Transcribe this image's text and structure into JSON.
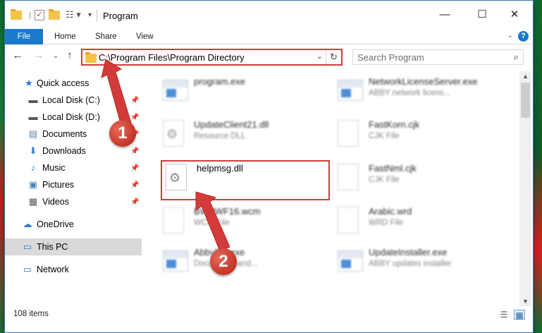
{
  "window": {
    "title": "Program",
    "controls": {
      "minimize": "—",
      "maximize": "☐",
      "close": "✕"
    }
  },
  "ribbon": {
    "tabs": [
      "File",
      "Home",
      "Share",
      "View"
    ],
    "help": "?"
  },
  "nav": {
    "back": "←",
    "forward": "→",
    "recent": "⌄",
    "up": "↑",
    "address": "C:\\Program Files\\Program Directory",
    "search_placeholder": "Search Program"
  },
  "sidebar": {
    "items": [
      {
        "label": "Quick access",
        "icon": "star-icon",
        "pinned": false
      },
      {
        "label": "Local Disk (C:)",
        "icon": "drive-icon",
        "pinned": true
      },
      {
        "label": "Local Disk (D:)",
        "icon": "drive-icon",
        "pinned": true
      },
      {
        "label": "Documents",
        "icon": "documents-icon",
        "pinned": true
      },
      {
        "label": "Downloads",
        "icon": "downloads-icon",
        "pinned": true
      },
      {
        "label": "Music",
        "icon": "music-icon",
        "pinned": true
      },
      {
        "label": "Pictures",
        "icon": "pictures-icon",
        "pinned": true
      },
      {
        "label": "Videos",
        "icon": "videos-icon",
        "pinned": true
      },
      {
        "label": "OneDrive",
        "icon": "cloud-icon",
        "pinned": false
      },
      {
        "label": "This PC",
        "icon": "computer-icon",
        "pinned": false,
        "selected": true
      },
      {
        "label": "Network",
        "icon": "network-icon",
        "pinned": false
      }
    ]
  },
  "files": [
    {
      "name": "program.exe",
      "type": "",
      "icon": "exe-icon"
    },
    {
      "name": "NetworkLicenseServer.exe",
      "type": "ABBY network licens...",
      "icon": "exe-icon"
    },
    {
      "name": "UpdateClient21.dll",
      "type": "Resource DLL",
      "icon": "dll-icon"
    },
    {
      "name": "FastKorn.cjk",
      "type": "CJK File",
      "icon": "file-icon"
    },
    {
      "name": "helpmsg.dll",
      "type": "",
      "icon": "dll-icon"
    },
    {
      "name": "FastNml.cjk",
      "type": "CJK File",
      "icon": "file-icon"
    },
    {
      "name": "BWPWF16.wcm",
      "type": "WCM File",
      "icon": "file-icon"
    },
    {
      "name": "Arabic.wrd",
      "type": "WRD File",
      "icon": "file-icon"
    },
    {
      "name": "AbbyFl9.exe",
      "type": "Document hand...",
      "icon": "exe-icon"
    },
    {
      "name": "UpdateInstaller.exe",
      "type": "ABBY updates installer",
      "icon": "exe-icon"
    }
  ],
  "status": {
    "item_count": "108 items"
  },
  "annotations": {
    "step1": "1",
    "step2": "2",
    "color": "#d33b3b"
  }
}
